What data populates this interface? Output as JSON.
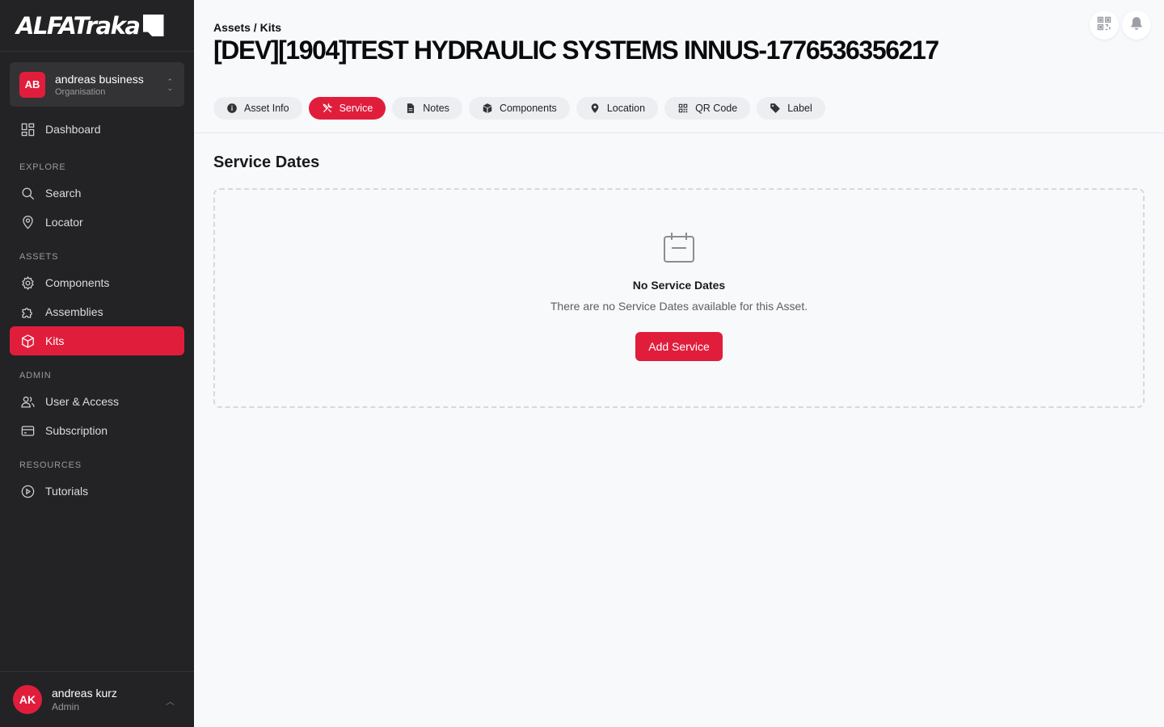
{
  "brand": {
    "logo_text": "ALFATraka"
  },
  "org": {
    "initials": "AB",
    "name": "andreas business",
    "subtitle": "Organisation"
  },
  "nav": {
    "dashboard": "Dashboard",
    "explore_label": "EXPLORE",
    "search": "Search",
    "locator": "Locator",
    "assets_label": "ASSETS",
    "components": "Components",
    "assemblies": "Assemblies",
    "kits": "Kits",
    "admin_label": "ADMIN",
    "user_access": "User & Access",
    "subscription": "Subscription",
    "resources_label": "RESOURCES",
    "tutorials": "Tutorials"
  },
  "user": {
    "initials": "AK",
    "name": "andreas kurz",
    "role": "Admin"
  },
  "header": {
    "breadcrumb": "Assets / Kits",
    "title": "[DEV][1904]TEST HYDRAULIC SYSTEMS INNUS-1776536356217"
  },
  "tabs": [
    {
      "label": "Asset Info",
      "icon": "info-icon"
    },
    {
      "label": "Service",
      "icon": "tools-icon",
      "active": true
    },
    {
      "label": "Notes",
      "icon": "document-icon"
    },
    {
      "label": "Components",
      "icon": "cube-icon"
    },
    {
      "label": "Location",
      "icon": "map-pin-icon"
    },
    {
      "label": "QR Code",
      "icon": "qr-code-icon"
    },
    {
      "label": "Label",
      "icon": "tag-icon"
    }
  ],
  "service": {
    "section_title": "Service Dates",
    "empty_title": "No Service Dates",
    "empty_desc": "There are no Service Dates available for this Asset.",
    "add_button": "Add Service"
  },
  "colors": {
    "accent": "#e11d3c",
    "sidebar_bg": "#232325",
    "page_bg": "#f8f9fb"
  }
}
